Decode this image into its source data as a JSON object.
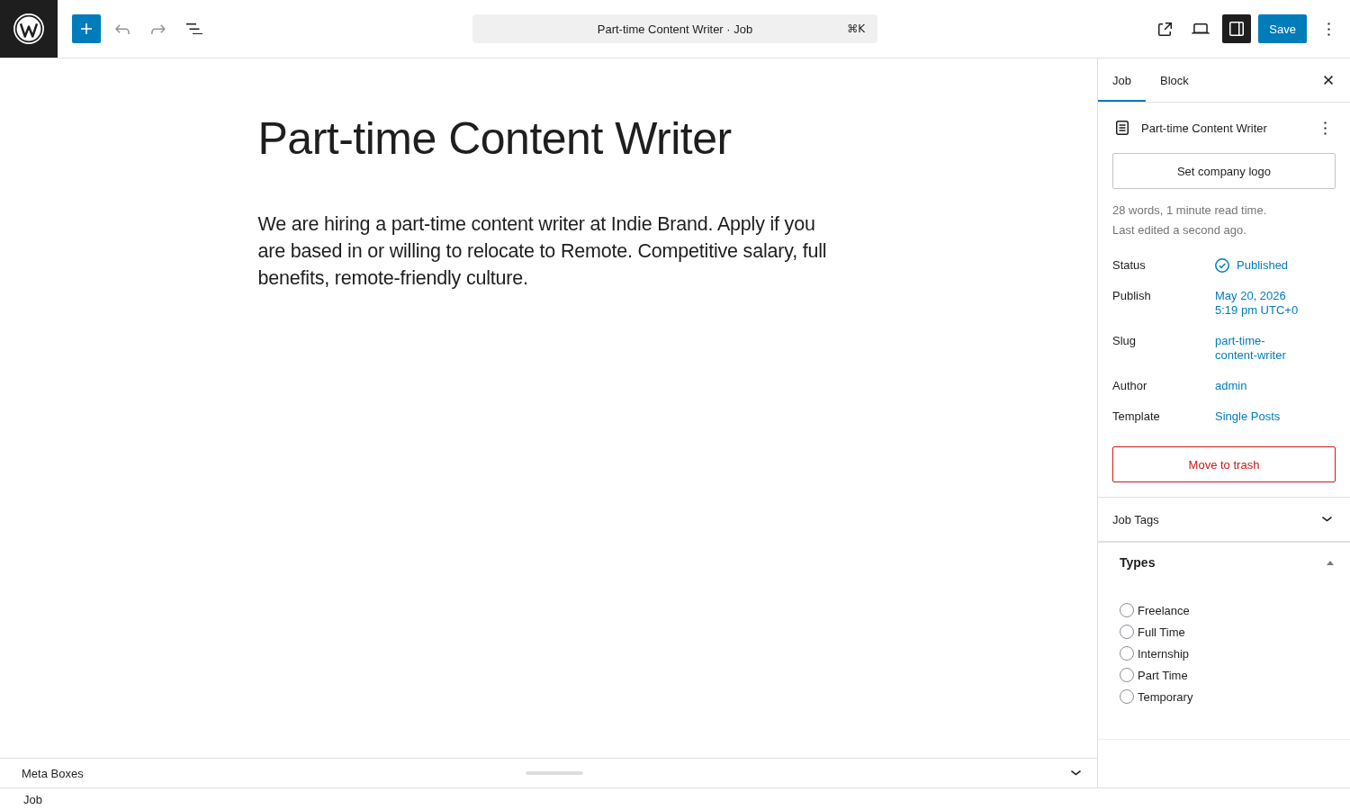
{
  "toolbar": {
    "undo": {
      "disabled": true
    },
    "redo": {
      "disabled": true
    },
    "command_bar": {
      "title": "Part-time Content Writer · Job",
      "shortcut": "⌘K"
    },
    "sidebar_toggle": {
      "on": true
    },
    "save_button": "Save"
  },
  "editor": {
    "title": "Part-time Content Writer",
    "paragraph": "We are hiring a part-time content writer at Indie Brand. Apply if you are based in or willing to relocate to Remote. Competitive salary, full benefits, remote-friendly culture."
  },
  "meta_boxes": {
    "title": "Meta Boxes",
    "expanded": false
  },
  "sidebar": {
    "tabs": [
      {
        "label": "Job",
        "selected": true
      },
      {
        "label": "Block",
        "selected": false
      }
    ],
    "post_title": "Part-time Content Writer",
    "logo_button": "Set company logo",
    "stats": [
      "28 words, 1 minute read time.",
      "Last edited a second ago."
    ],
    "fields": [
      {
        "label": "Status",
        "value": "Published",
        "kind": "status"
      },
      {
        "label": "Publish",
        "value": "May 20, 2026 5:19 pm UTC+0",
        "kind": "link"
      },
      {
        "label": "Slug",
        "value": "part-time-content-writer",
        "kind": "link"
      },
      {
        "label": "Author",
        "value": "admin",
        "kind": "link"
      },
      {
        "label": "Template",
        "value": "Single Posts",
        "kind": "link"
      }
    ],
    "trash_button": "Move to trash",
    "job_tags_panel": {
      "title": "Job Tags",
      "expanded": false
    },
    "types_box": {
      "title": "Types",
      "expanded": true,
      "options": [
        {
          "label": "Freelance",
          "selected": false
        },
        {
          "label": "Full Time",
          "selected": false
        },
        {
          "label": "Internship",
          "selected": false
        },
        {
          "label": "Part Time",
          "selected": false
        },
        {
          "label": "Temporary",
          "selected": false
        }
      ]
    }
  },
  "breadcrumb": "Job"
}
